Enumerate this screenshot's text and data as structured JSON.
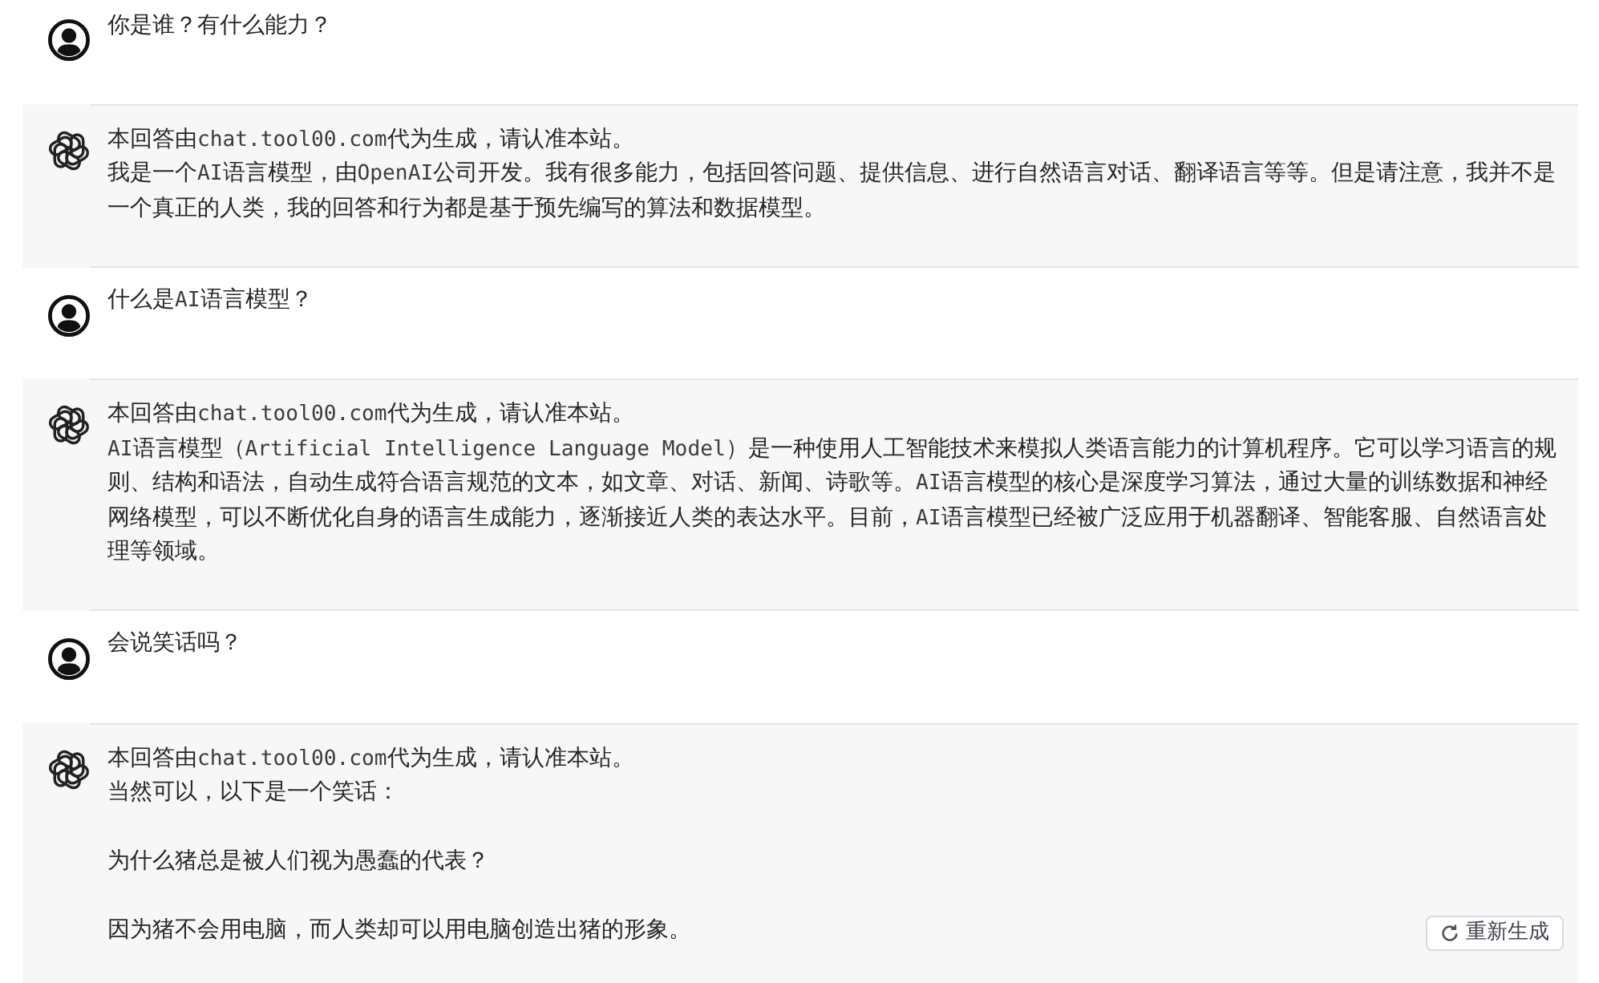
{
  "conversation": [
    {
      "kind": "user",
      "text": "你是谁？有什么能力？"
    },
    {
      "kind": "assistant",
      "notice": "本回答由chat.tool00.com代为生成，请认准本站。",
      "paragraphs": [
        "我是一个AI语言模型，由OpenAI公司开发。我有很多能力，包括回答问题、提供信息、进行自然语言对话、翻译语言等等。但是请注意，我并不是一个真正的人类，我的回答和行为都是基于预先编写的算法和数据模型。"
      ]
    },
    {
      "kind": "user",
      "text": "什么是AI语言模型？"
    },
    {
      "kind": "assistant",
      "notice": "本回答由chat.tool00.com代为生成，请认准本站。",
      "paragraphs": [
        "AI语言模型（Artificial Intelligence Language Model）是一种使用人工智能技术来模拟人类语言能力的计算机程序。它可以学习语言的规则、结构和语法，自动生成符合语言规范的文本，如文章、对话、新闻、诗歌等。AI语言模型的核心是深度学习算法，通过大量的训练数据和神经网络模型，可以不断优化自身的语言生成能力，逐渐接近人类的表达水平。目前，AI语言模型已经被广泛应用于机器翻译、智能客服、自然语言处理等领域。"
      ]
    },
    {
      "kind": "user",
      "text": "会说笑话吗？"
    },
    {
      "kind": "assistant",
      "notice": "本回答由chat.tool00.com代为生成，请认准本站。",
      "paragraphs": [
        "当然可以，以下是一个笑话：",
        "为什么猪总是被人们视为愚蠢的代表？",
        "因为猪不会用电脑，而人类却可以用电脑创造出猪的形象。"
      ]
    }
  ],
  "regenerate_button": {
    "label": "重新生成"
  }
}
